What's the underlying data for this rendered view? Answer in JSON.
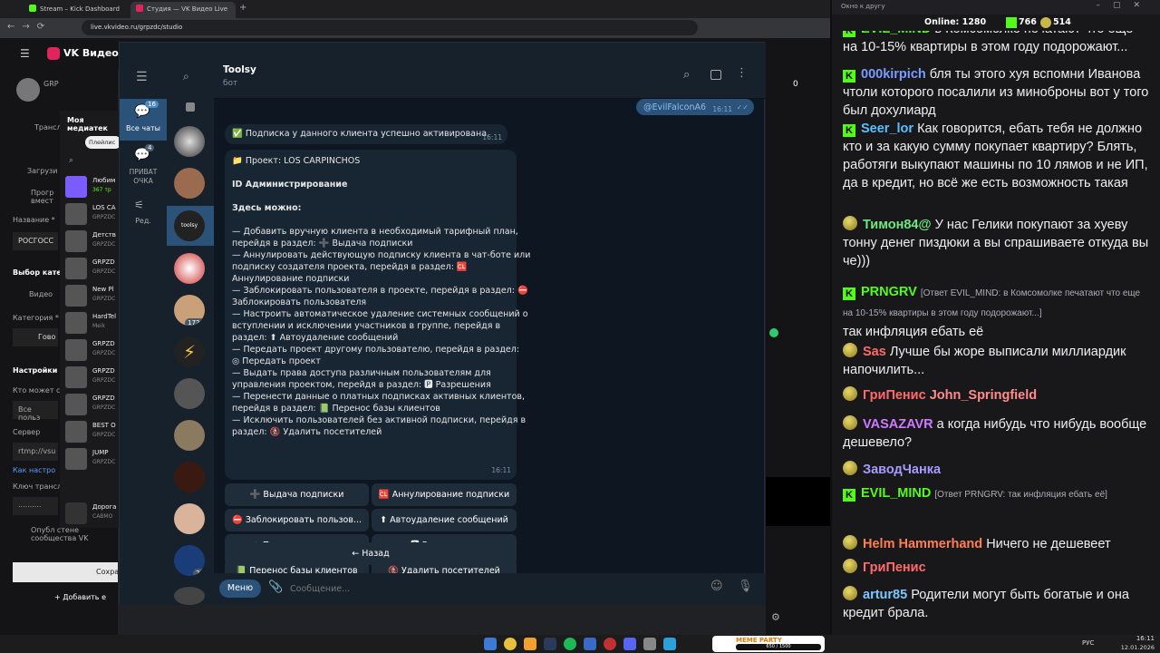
{
  "browser": {
    "tabs": [
      {
        "label": "Stream – Kick Dashboard",
        "color": "#53fc18"
      },
      {
        "label": "Студия — VK Видео Live",
        "color": "#e0245e"
      }
    ],
    "url": "live.vkvideo.ru/grpzdc/studio",
    "brand": "VK Видео"
  },
  "vk": {
    "side": [
      "GRP",
      "Трансл",
      "Загрузи",
      "Прогр вмест",
      "Название *",
      "РОСГОСС",
      "Выбор кате",
      "Видео",
      "Категория *",
      "Гово",
      "Настройки",
      "Кто может с",
      "Все польз",
      "Сервер",
      "rtmp://vsu",
      "Как настро",
      "Ключ трансл",
      "..........",
      "Опубл стене сообщества VK",
      "Сохра",
      "Добавить е"
    ],
    "media_title": "Моя медиатек",
    "media_filter": "Плейлис",
    "media": [
      {
        "t": "Любим",
        "s": "367 тр"
      },
      {
        "t": "LOS CA",
        "s": "GRPZDC"
      },
      {
        "t": "Детств",
        "s": "GRPZDC"
      },
      {
        "t": "GRPZD",
        "s": "GRPZDC"
      },
      {
        "t": "New Pl",
        "s": "GRPZDC"
      },
      {
        "t": "HardTel",
        "s": "Meik"
      },
      {
        "t": "GRPZD",
        "s": "GRPZDC"
      },
      {
        "t": "GRPZD",
        "s": "GRPZDC"
      },
      {
        "t": "GRPZD",
        "s": "GRPZDC"
      },
      {
        "t": "BEST O",
        "s": "GRPZDC"
      },
      {
        "t": "JUMP",
        "s": "GRPZDC"
      }
    ],
    "player": {
      "t": "Дорога",
      "s": "САВМО"
    },
    "viewers": "0"
  },
  "tg": {
    "folders": [
      {
        "label": "Все чаты",
        "badge": "16"
      },
      {
        "label": "ПРИВАТ ОЧКА",
        "badge": "4"
      },
      {
        "label": "Ред."
      }
    ],
    "chat_badges": [
      "1724",
      "29"
    ],
    "bot_name": "Toolsy",
    "bot_status": "бот",
    "out_msg": "@EvilFalconA6",
    "out_time": "16:11",
    "msg1": "✅ Подписка у данного клиента успешно активирована.",
    "msg1_time": "16:11",
    "project": "📁 Проект: LOS CARPINCHOS",
    "admin": "ID Администрирование",
    "here": "Здесь можно:",
    "lines": [
      "— Добавить вручную клиента в необходимый тарифный план,",
      "перейдя в раздел: ➕ Выдача подписки",
      "— Аннулировать действующую подписку клиента в чат-боте или",
      "подписку создателя проекта, перейдя в раздел: 🆑",
      "Аннулирование подписки",
      "— Заблокировать пользователя в проекте, перейдя в раздел: ⛔",
      "Заблокировать пользователя",
      "— Настроить автоматическое удаление системных сообщений о",
      "вступлении и исключении участников в группе, перейдя в",
      "раздел: ⬆ Автоудаление сообщений",
      "— Передать проект другому пользователю, перейдя в раздел:",
      "◎ Передать проект",
      "— Выдать права доступа различным пользователям для",
      "управления проектом, перейдя в раздел: 🅿 Разрешения",
      "— Перенести данные о платных подписках активных клиентов,",
      "перейдя в раздел: 📗 Перенос базы клиентов",
      "— Исключить пользователей без активной подписки, перейдя в",
      "раздел: 🚷 Удалить посетителей"
    ],
    "msg2_time": "16:11",
    "buttons": [
      [
        "➕ Выдача подписки",
        "🆑 Аннулирование подписки"
      ],
      [
        "⛔ Заблокировать пользов...",
        "⬆ Автоудаление сообщений"
      ],
      [
        "◎ Передать проект",
        "🅿 Разрешения"
      ],
      [
        "📗 Перенос базы клиентов",
        "🚷 Удалить посетителей"
      ]
    ],
    "back": "← Назад",
    "menu": "Меню",
    "placeholder": "Сообщение..."
  },
  "chat": {
    "window_title": "Окно к другу",
    "online": "Online: 1280",
    "k_count": "766",
    "e_count": "514",
    "messages": [
      {
        "name": "EVIL_MIND",
        "color": "#53fc18",
        "kick": true,
        "text": "в Комсомолке печатают что еще на 10-15% квартиры в этом году подорожают..."
      },
      {
        "name": "000kirpich",
        "color": "#7a9bff",
        "kick": true,
        "text": "бля ты этого хуя вспомни Иванова чтоли которого посалили из миноброны вот у того был дохулиард"
      },
      {
        "name": "Seer_lor",
        "color": "#5bc0ff",
        "kick": true,
        "text": "Как говорится, ебать тебя не должно кто и за какую сумму покупает квартиру? Блять, работяги выкупают машины по 10 лямов и не ИП, да в кредит, но всё же есть возможность такая"
      },
      {
        "name": "Тимон84@",
        "color": "#6fe87f",
        "kick": false,
        "text": "У нас Гелики покупают за хуеву тонну денег пиздюки а вы спрашиваете откуда вы че)))"
      },
      {
        "name": "PRNGRV",
        "color": "#53fc18",
        "kick": true,
        "reply": "[Ответ EVIL_MIND: в Комсомолке печатают что еще на 10-15% квартиры в этом году подорожают...]",
        "text": "так инфляция ебать её"
      },
      {
        "name": "Sas",
        "color": "#ff6b6b",
        "kick": false,
        "text": "Лучше бы жоре выписали миллиардик напочилить..."
      },
      {
        "name": "ГриПенис",
        "color": "#ff6b6b",
        "kick": false,
        "text": "John_Springfield",
        "text_color": "#ff8c8c"
      },
      {
        "name": "VASAZAVR",
        "color": "#d07aff",
        "kick": false,
        "text": "а когда нибудь что нибудь вообще дешевело?"
      },
      {
        "name": "ЗаводЧанка",
        "color": "#a79bff",
        "kick": false,
        "text": ""
      },
      {
        "name": "EVIL_MIND",
        "color": "#53fc18",
        "kick": true,
        "reply": "[Ответ PRNGRV: так инфляция ебать её]",
        "text": ""
      },
      {
        "name": "Helm Hammerhand",
        "color": "#ff7f50",
        "kick": false,
        "text": "Ничего не дешевеет"
      },
      {
        "name": "ГриПенис",
        "color": "#ff6b6b",
        "kick": false,
        "text": ""
      },
      {
        "name": "artur85",
        "color": "#7ac8ff",
        "kick": false,
        "text": "Родители могут быть богатые и она кредит брала."
      }
    ]
  },
  "taskbar": {
    "lang": "РУС",
    "time": "16:11",
    "date": "12.01.2026",
    "meme": "MEME PARTY",
    "meme_count": "650 / 1500"
  }
}
